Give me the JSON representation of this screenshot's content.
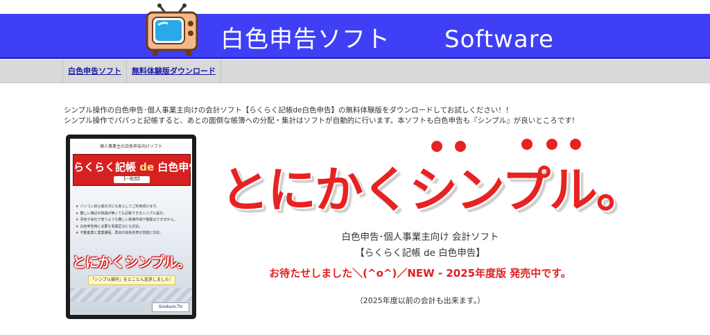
{
  "header": {
    "title_jp": "白色申告ソフト",
    "title_en": "Software",
    "colors": {
      "band": "#3f3ff5",
      "text": "#ffffff"
    },
    "logo_icon": "tv-icon"
  },
  "nav": {
    "items": [
      {
        "label": "白色申告ソフト"
      },
      {
        "label": "無料体験版ダウンロード"
      }
    ]
  },
  "intro": {
    "line1": "シンプル操作の白色申告･個人事業主向けの会計ソフト【らくらく記帳de白色申告】の無料体験版をダウンロードしてお試しください！！",
    "line2": "シンプル操作でパパっと記帳すると、あとの面倒な帳簿への分配・集計はソフトが自動的に行います。本ソフトも白色申告も『シンプル』が良いところです!"
  },
  "product_box": {
    "sub_heading": "個人事業主の白色申告向けソフト",
    "title_a": "らくらく記帳",
    "title_de": "de",
    "title_b": "白色申告",
    "version_badge": "【一般用】",
    "features": [
      "パソコン初心者の方にも安心してご利用頂けます。",
      "難しい簿記の知識が無くても記帳できるシンプル設計。",
      "青色や会社で使うような難しい帳簿作成や機能はできません。",
      "白色申告時に必要な事業区分にも対応。",
      "不動産業と農業課程、再出の染色別表が割能に対応。"
    ],
    "slogan": "とにかくシンプル。",
    "slogan_sub": "「シンプル操作」をとことん追求しました！",
    "logo_text": "Sirokuro.TV"
  },
  "main": {
    "big_slogan": "とにかくシンプル。",
    "big_slogan_color": "#e82222",
    "subtitle": "白色申告･個人事業主向け 会計ソフト",
    "product_name": "【らくらく記帳 de 白色申告】",
    "announcement": "お待たせしました＼(^o^)／NEW - 2025年度版 発売中です。",
    "announcement_color": "#e02020",
    "note": "（2025年度以前の会計も出来ます。）"
  }
}
